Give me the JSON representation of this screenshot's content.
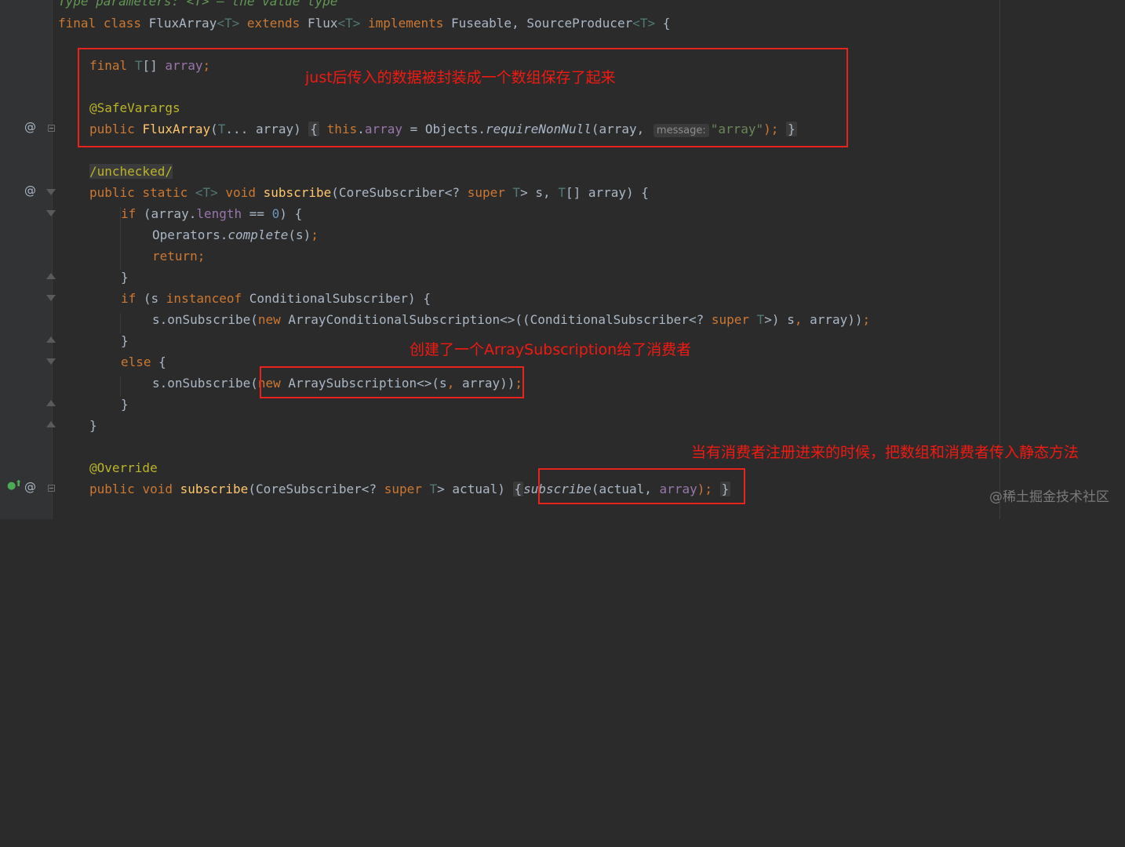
{
  "code": {
    "l0_comment": "Type parameters: <T> – the value type",
    "l1_final": "final",
    "l1_class": "class",
    "l1_name": "FluxArray",
    "l1_tp1": "<T>",
    "l1_extends": "extends",
    "l1_flux": "Flux",
    "l1_tp2": "<T>",
    "l1_implements": "implements",
    "l1_rest": "Fuseable,",
    "l1_sp": "SourceProducer",
    "l1_tp3": "<T>",
    "l1_brace": " {",
    "l2_final": "final",
    "l2_type": "T",
    "l2_arr": "[]",
    "l2_field": "array",
    "l2_semi": ";",
    "l3_ann": "@SafeVarargs",
    "l4_public": "public",
    "l4_name": "FluxArray",
    "l4_open": "(",
    "l4_tp": "T",
    "l4_params": "... array)",
    "l4_brace_open": "{",
    "l4_this": "this",
    "l4_dot": ".",
    "l4_field": "array",
    "l4_eq": " = Objects.",
    "l4_call": "requireNonNull",
    "l4_args": "(array,",
    "l4_hint": "message:",
    "l4_str": "\"array\"",
    "l4_end": ");",
    "l4_brace_close": "}",
    "l5_ann": "/unchecked/",
    "l6_public": "public",
    "l6_static": "static",
    "l6_tp": "<T>",
    "l6_void": "void",
    "l6_name": "subscribe",
    "l6_p1": "(CoreSubscriber<? ",
    "l6_super": "super",
    "l6_tp2": "T",
    "l6_p2": "> s,",
    "l6_tp3": "T",
    "l6_p3": "[] array) {",
    "l7_if": "if",
    "l7_a": " (array.",
    "l7_len": "length",
    "l7_b": " == ",
    "l7_num": "0",
    "l7_c": ") {",
    "l8_ops": "Operators.",
    "l8_call": "complete",
    "l8_args": "(s)",
    "l8_semi": ";",
    "l9_return": "return;",
    "l10_brace": "}",
    "l11_if": "if",
    "l11_a": " (s ",
    "l11_inst": "instanceof",
    "l11_b": " ConditionalSubscriber) {",
    "l12_a": "s.onSubscribe(",
    "l12_new": "new",
    "l12_b": " ArrayConditionalSubscription<>((ConditionalSubscriber<? ",
    "l12_super": "super",
    "l12_tp": "T",
    "l12_c": ">) s",
    "l12_comma": ",",
    "l12_d": " array))",
    "l12_semi": ";",
    "l13_brace": "}",
    "l14_else": "else",
    "l14_brace": " {",
    "l15_a": "s.onSubscribe(",
    "l15_new": "new",
    "l15_b": " ArraySubscription<>(s",
    "l15_comma": ",",
    "l15_c": " array))",
    "l15_semi": ";",
    "l16_brace": "}",
    "l17_brace": "}",
    "l18_ann": "@Override",
    "l19_public": "public",
    "l19_void": "void",
    "l19_name": "subscribe",
    "l19_p1": "(CoreSubscriber<? ",
    "l19_super": "super",
    "l19_tp": "T",
    "l19_p2": "> actual)",
    "l19_brace_open": "{",
    "l19_call": "subscribe",
    "l19_args": "(actual,",
    "l19_field": "array",
    "l19_end": ");",
    "l19_brace_close": "}"
  },
  "annotations": {
    "note1": "just后传入的数据被封装成一个数组保存了起来",
    "note2": "创建了一个ArraySubscription给了消费者",
    "note3": "当有消费者注册进来的时候，把数组和消费者传入静态方法"
  },
  "gutter": {
    "at_symbol": "@",
    "override_icon": "⬆",
    "implement_icon": "●"
  },
  "watermark": "@稀土掘金技术社区",
  "colors": {
    "keyword": "#cc7832",
    "function": "#ffc66d",
    "annotation": "#bbb529",
    "field": "#9876aa",
    "string": "#6a8759",
    "number": "#6897bb",
    "type_param": "#507874",
    "highlight_box": "#e8231b",
    "note_text": "#f01a12"
  }
}
